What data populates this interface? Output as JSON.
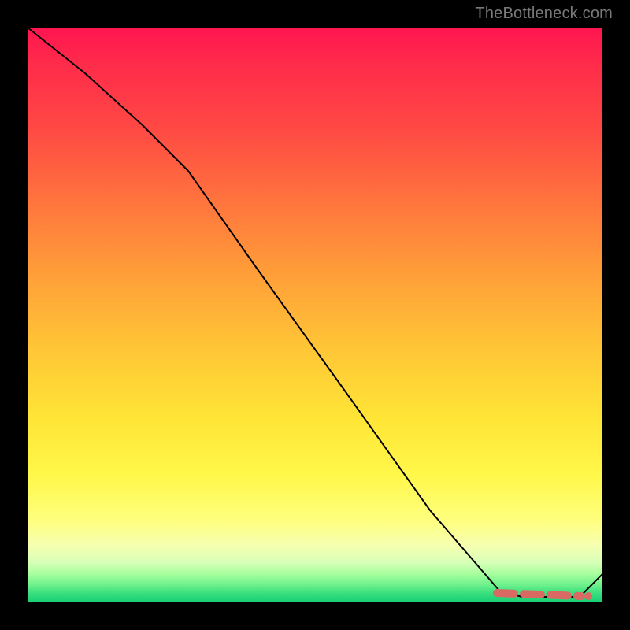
{
  "watermark": "TheBottleneck.com",
  "colors": {
    "curve": "#000000",
    "flat_segment": "#d96a63",
    "gradient_top": "#ff1550",
    "gradient_bottom": "#18cf74"
  },
  "chart_data": {
    "type": "line",
    "title": "",
    "xlabel": "",
    "ylabel": "",
    "xlim": [
      0,
      100
    ],
    "ylim": [
      0,
      100
    ],
    "grid": false,
    "series": [
      {
        "name": "bottleneck-curve",
        "x": [
          0,
          10,
          20,
          28,
          40,
          55,
          70,
          82,
          86,
          90,
          93,
          96,
          100
        ],
        "y": [
          100,
          92,
          83,
          75,
          58,
          37,
          16,
          2,
          1,
          1,
          1,
          1,
          5
        ]
      }
    ],
    "highlight_flat_segment": {
      "name": "optimal-range",
      "x_start": 82,
      "x_end": 96,
      "y": 1,
      "style": "dashed",
      "color": "#d96a63"
    }
  }
}
